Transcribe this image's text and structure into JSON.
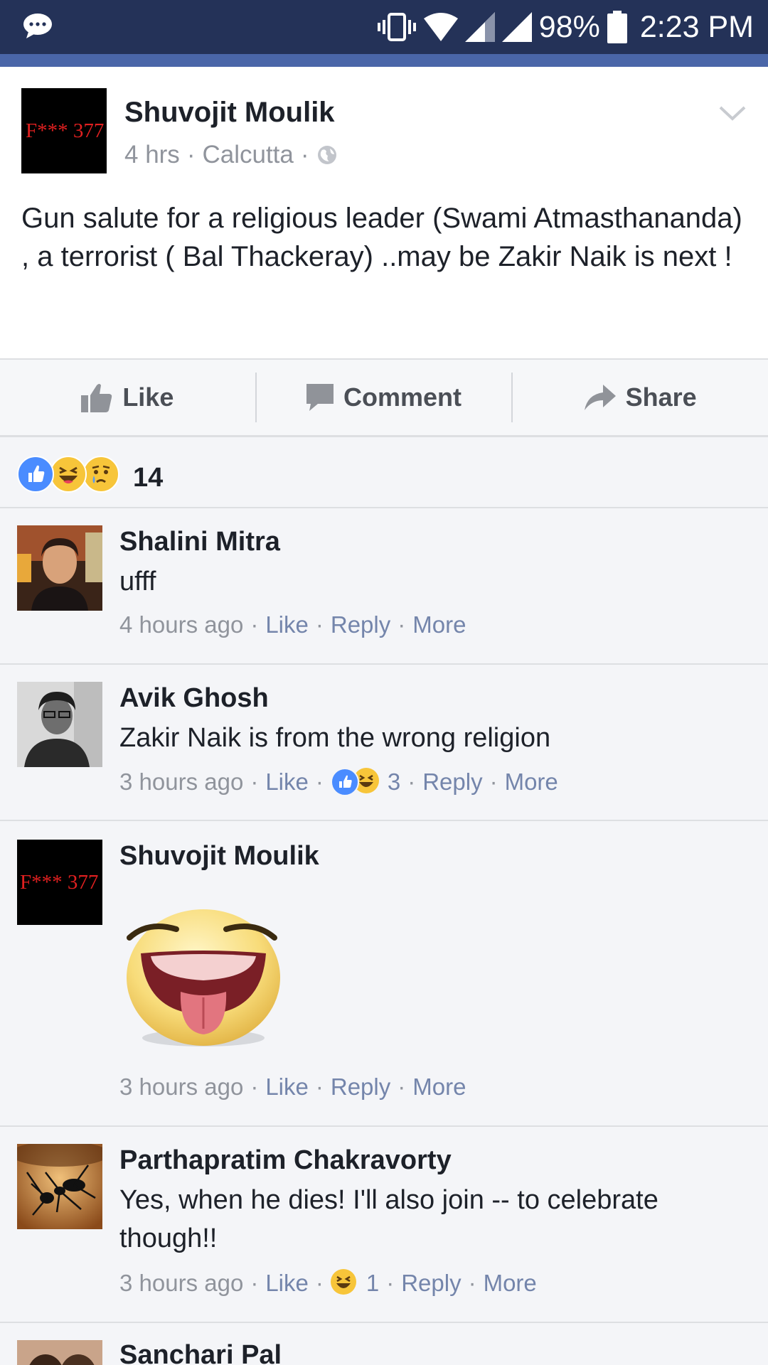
{
  "status_bar": {
    "battery": "98%",
    "time": "2:23 PM"
  },
  "post": {
    "avatar_text": "F*** 377",
    "author": "Shuvojit Moulik",
    "time": "4 hrs",
    "location": "Calcutta",
    "body": "Gun salute for a religious leader (Swami Atmasthananda) , a terrorist ( Bal Thackeray) ..may be Zakir Naik is next !"
  },
  "actions": {
    "like": "Like",
    "comment": "Comment",
    "share": "Share"
  },
  "reactions": {
    "count": "14",
    "types": [
      "like",
      "haha",
      "sad"
    ]
  },
  "comments": [
    {
      "name": "Shalini Mitra",
      "text": "ufff",
      "time": "4 hours ago",
      "like": "Like",
      "reply": "Reply",
      "more": "More"
    },
    {
      "name": "Avik Ghosh",
      "text": "Zakir Naik is from the wrong religion",
      "time": "3 hours ago",
      "like": "Like",
      "reaction_count": "3",
      "reply": "Reply",
      "more": "More"
    },
    {
      "name": "Shuvojit Moulik",
      "avatar_text": "F*** 377",
      "sticker": "tongue-out-emoji-sticker",
      "time": "3 hours ago",
      "like": "Like",
      "reply": "Reply",
      "more": "More"
    },
    {
      "name": "Parthapratim Chakravorty",
      "text": "Yes, when he dies! I'll also join -- to celebrate though!!",
      "time": "3 hours ago",
      "like": "Like",
      "reaction_count": "1",
      "reply": "Reply",
      "more": "More"
    },
    {
      "name": "Sanchari Pal"
    }
  ],
  "colors": {
    "status_bar": "#243258",
    "nav_strip": "#4a66a8",
    "link": "#7485ab",
    "meta_gray": "#90949c",
    "like_blue": "#4a8cff",
    "emoji_yellow": "#f7c53a"
  }
}
